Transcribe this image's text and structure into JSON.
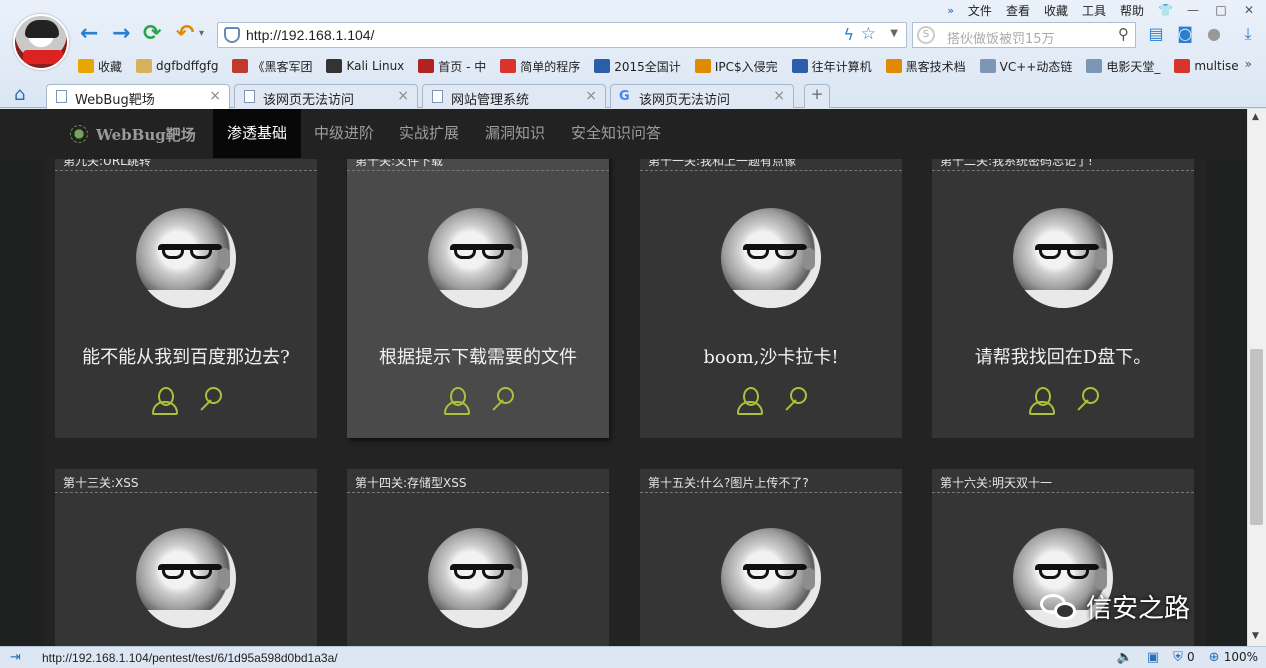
{
  "browser": {
    "menu": [
      "文件",
      "查看",
      "收藏",
      "工具",
      "帮助"
    ],
    "address": "http://192.168.1.104/",
    "search_placeholder": "搭伙做饭被罚15万",
    "bookmarks": [
      {
        "label": "收藏",
        "icon": "star-icon",
        "color": "#e6a800"
      },
      {
        "label": "dgfbdffgfg",
        "icon": "folder-icon",
        "color": "#d8b25a"
      },
      {
        "label": "《黑客军团",
        "icon": "site-icon",
        "color": "#c0392b"
      },
      {
        "label": "Kali Linux",
        "icon": "kali-icon",
        "color": "#333333"
      },
      {
        "label": "首页 - 中",
        "icon": "huc-icon",
        "color": "#b22222"
      },
      {
        "label": "简单的程序",
        "icon": "c-icon",
        "color": "#d9342b"
      },
      {
        "label": "2015全国计",
        "icon": "paw-icon",
        "color": "#2a5ea8"
      },
      {
        "label": "IPC$入侵完",
        "icon": "site-icon",
        "color": "#e08a00"
      },
      {
        "label": "往年计算机",
        "icon": "paw-icon",
        "color": "#2a5ea8"
      },
      {
        "label": "黑客技术档",
        "icon": "site-icon",
        "color": "#e08a00"
      },
      {
        "label": "VC++动态链",
        "icon": "page-icon",
        "color": "#7d96b6"
      },
      {
        "label": "电影天堂_",
        "icon": "page-icon",
        "color": "#7d96b6"
      },
      {
        "label": "multise",
        "icon": "c-icon",
        "color": "#d9342b"
      }
    ],
    "tabs": [
      {
        "label": "WebBug靶场",
        "active": true
      },
      {
        "label": "该网页无法访问",
        "active": false
      },
      {
        "label": "网站管理系统",
        "active": false
      },
      {
        "label": "该网页无法访问",
        "active": false,
        "google": true
      }
    ],
    "new_tab": "+",
    "status_url": "http://192.168.1.104/pentest/test/6/1d95a598d0bd1a3a/",
    "status_count": "0",
    "zoom": "100%"
  },
  "site": {
    "brand": "WebBug靶场",
    "nav": [
      {
        "label": "渗透基础",
        "active": true
      },
      {
        "label": "中级进阶",
        "active": false
      },
      {
        "label": "实战扩展",
        "active": false
      },
      {
        "label": "漏洞知识",
        "active": false
      },
      {
        "label": "安全知识问答",
        "active": false
      }
    ],
    "cards_row1": [
      {
        "title": "第九关:URL跳转",
        "text": "能不能从我到百度那边去?"
      },
      {
        "title": "第十关:文件下载",
        "text": "根据提示下载需要的文件"
      },
      {
        "title": "第十一关:我和上一题有点像",
        "text": "boom,沙卡拉卡!"
      },
      {
        "title": "第十二关:我系统密码忘记了!",
        "text": "请帮我找回在D盘下。"
      }
    ],
    "cards_row2": [
      {
        "title": "第十三关:XSS"
      },
      {
        "title": "第十四关:存储型XSS"
      },
      {
        "title": "第十五关:什么?图片上传不了?"
      },
      {
        "title": "第十六关:明天双十一"
      }
    ]
  },
  "watermark": "信安之路"
}
